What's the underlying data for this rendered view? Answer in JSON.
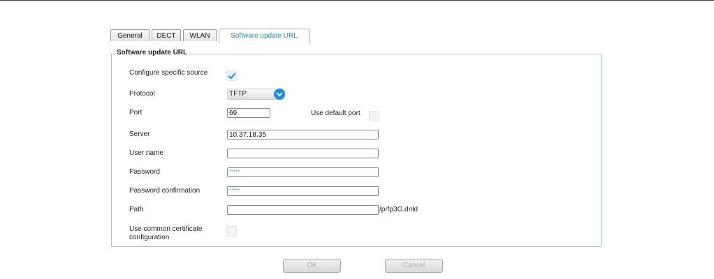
{
  "tabs": [
    {
      "label": "General"
    },
    {
      "label": "DECT"
    },
    {
      "label": "WLAN"
    },
    {
      "label": "Software update URL"
    }
  ],
  "section": {
    "title": "Software update URL"
  },
  "form": {
    "configure_specific_source": {
      "label": "Configure specific source",
      "checked": true
    },
    "protocol": {
      "label": "Protocol",
      "value": "TFTP"
    },
    "port": {
      "label": "Port",
      "value": "69"
    },
    "use_default_port": {
      "label": "Use default port",
      "checked": false
    },
    "server": {
      "label": "Server",
      "value": "10.37.18.35"
    },
    "user_name": {
      "label": "User name",
      "value": ""
    },
    "password": {
      "label": "Password",
      "value": "*****"
    },
    "password_confirmation": {
      "label": "Password confirmation",
      "value": "*****"
    },
    "path": {
      "label": "Path",
      "value": "",
      "suffix": "/prfp3G.dnld"
    },
    "use_common_certificate": {
      "label_line1": "Use common certificate",
      "label_line2": "configuration",
      "checked": false
    }
  },
  "buttons": {
    "ok": "OK",
    "cancel": "Cancel"
  },
  "colors": {
    "active_tab_text": "#1a8fc0",
    "dropdown_accent": "#1f8cd8",
    "checkmark": "#1f8cd8",
    "fieldset_border": "#a7c4d6"
  }
}
